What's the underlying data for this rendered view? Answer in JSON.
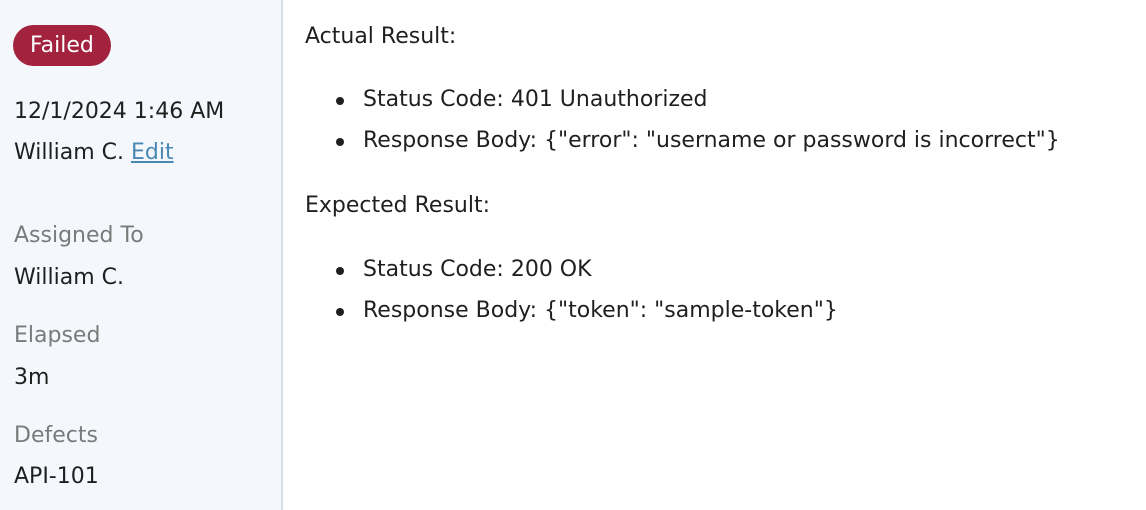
{
  "status": {
    "label": "Failed",
    "color": "#a3223e"
  },
  "run": {
    "datetime": "12/1/2024 1:46 AM",
    "user": "William C.",
    "edit_label": "Edit"
  },
  "fields": {
    "assigned_to_label": "Assigned To",
    "assigned_to_value": "William C.",
    "elapsed_label": "Elapsed",
    "elapsed_value": "3m",
    "defects_label": "Defects",
    "defects_value": "API-101"
  },
  "result": {
    "actual_title": "Actual Result:",
    "actual_items": [
      "Status Code: 401 Unauthorized",
      "Response Body: {\"error\": \"username or password is incorrect\"}"
    ],
    "expected_title": "Expected Result:",
    "expected_items": [
      "Status Code: 200 OK",
      "Response Body: {\"token\": \"sample-token\"}"
    ]
  }
}
